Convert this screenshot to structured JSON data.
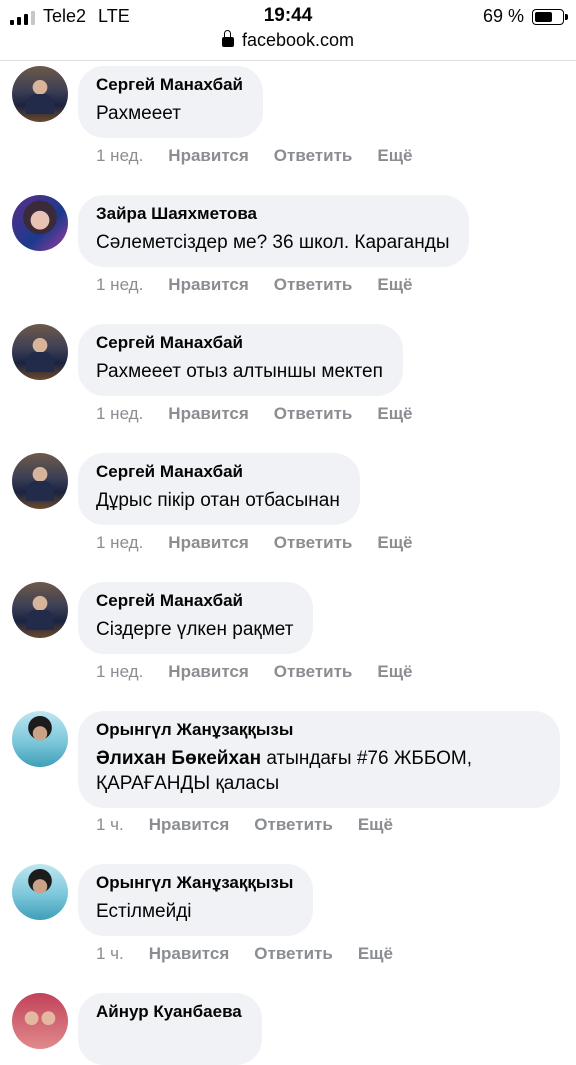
{
  "status_bar": {
    "carrier": "Tele2",
    "network": "LTE",
    "time": "19:44",
    "battery": "69 %",
    "battery_level": 0.69
  },
  "url_bar": {
    "domain": "facebook.com"
  },
  "action_labels": {
    "like": "Нравится",
    "reply": "Ответить",
    "more": "Ещё"
  },
  "comments": [
    {
      "author": "Сергей Манахбай",
      "text": "Рахмееет",
      "time": "1 нед."
    },
    {
      "author": "Зайра Шаяхметова",
      "text": "Сәлеметсіздер ме? 36 школ. Караганды",
      "time": "1 нед."
    },
    {
      "author": "Сергей Манахбай",
      "text": "Рахмееет отыз алтыншы мектеп",
      "time": "1 нед."
    },
    {
      "author": "Сергей Манахбай",
      "text": "Дұрыс пікір отан отбасынан",
      "time": "1 нед."
    },
    {
      "author": "Сергей Манахбай",
      "text": "Сіздерге үлкен рақмет",
      "time": "1 нед."
    },
    {
      "author": "Орынгүл Жанұзаққызы",
      "text_bold": "Әлихан Бөкейхан",
      "text": " атындағы #76 ЖББОМ, ҚАРАҒАНДЫ қаласы",
      "time": "1 ч."
    },
    {
      "author": "Орынгүл Жанұзаққызы",
      "text": "Естілмейді",
      "time": "1 ч."
    },
    {
      "author": "Айнур Куанбаева",
      "text": ""
    }
  ]
}
